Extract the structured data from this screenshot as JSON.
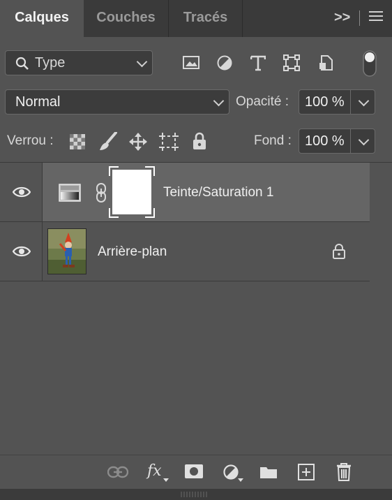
{
  "tabs": [
    {
      "label": "Calques",
      "active": true
    },
    {
      "label": "Couches",
      "active": false
    },
    {
      "label": "Tracés",
      "active": false
    }
  ],
  "panel_menu": {
    "expand_label": ">>",
    "menu_icon": "hamburger-icon"
  },
  "filter": {
    "search_icon": "search-icon",
    "value": "Type",
    "icons": [
      "image-filter-icon",
      "adjustment-filter-icon",
      "type-filter-icon",
      "shape-filter-icon",
      "smart-object-filter-icon",
      "filter-toggle-icon"
    ]
  },
  "blend": {
    "mode": "Normal",
    "opacity_label": "Opacité :",
    "opacity_value": "100 %"
  },
  "lock": {
    "label": "Verrou :",
    "icons": [
      "lock-transparency-icon",
      "lock-pixels-icon",
      "lock-position-icon",
      "lock-artboard-icon",
      "lock-all-icon"
    ],
    "fill_label": "Fond :",
    "fill_value": "100 %"
  },
  "layers": [
    {
      "name": "Teinte/Saturation 1",
      "visible": true,
      "selected": true,
      "type": "adjustment"
    },
    {
      "name": "Arrière-plan",
      "visible": true,
      "selected": false,
      "type": "background",
      "locked": true
    }
  ],
  "footer_icons": [
    "link-layers-icon",
    "fx-icon",
    "add-mask-icon",
    "new-adjustment-icon",
    "new-group-icon",
    "new-layer-icon",
    "delete-layer-icon"
  ],
  "colors": {
    "panel_bg": "#535353",
    "tab_bg": "#3a3a3a",
    "selected_row": "#656565"
  }
}
